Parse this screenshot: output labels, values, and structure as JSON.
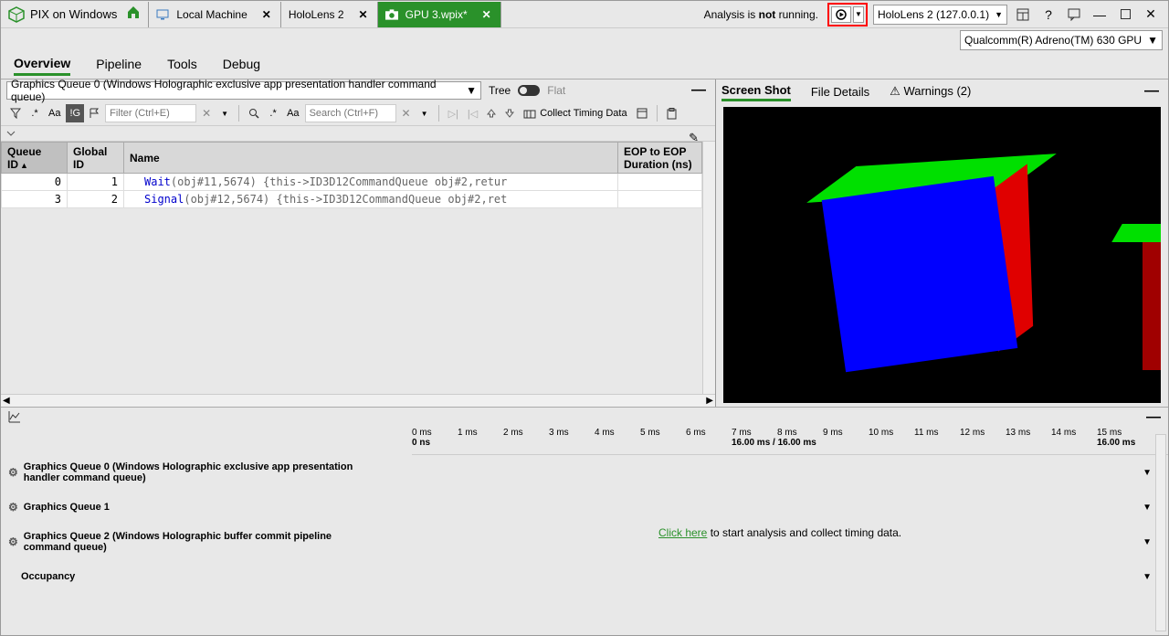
{
  "app": {
    "title": "PIX on Windows"
  },
  "documents": [
    {
      "label": "Local Machine"
    },
    {
      "label": "HoloLens 2"
    },
    {
      "label": "GPU 3.wpix*"
    }
  ],
  "status": {
    "prefix": "Analysis is ",
    "bold": "not",
    "suffix": " running."
  },
  "device": {
    "selected": "HoloLens 2 (127.0.0.1)"
  },
  "gpu": {
    "selected": "Qualcomm(R) Adreno(TM) 630 GPU"
  },
  "menu": {
    "items": [
      "Overview",
      "Pipeline",
      "Tools",
      "Debug"
    ]
  },
  "queue": {
    "selected": "Graphics Queue 0 (Windows Holographic exclusive app presentation handler command queue)",
    "treeLabel": "Tree",
    "flatLabel": "Flat"
  },
  "filter1": {
    "regex": ".*",
    "aa": "Aa",
    "ig": "!G",
    "placeholder": "Filter (Ctrl+E)"
  },
  "filter2": {
    "regex": ".*",
    "aa": "Aa",
    "placeholder": "Search (Ctrl+F)"
  },
  "collectLabel": "Collect Timing Data",
  "table": {
    "cols": {
      "qid": "Queue ID",
      "gid": "Global ID",
      "name": "Name",
      "dur": "EOP to EOP Duration (ns)"
    },
    "rows": [
      {
        "qid": "0",
        "gid": "1",
        "fn": "Wait",
        "args": "(obj#11,5674)  {this->ID3D12CommandQueue obj#2,retur"
      },
      {
        "qid": "3",
        "gid": "2",
        "fn": "Signal",
        "args": "(obj#12,5674)  {this->ID3D12CommandQueue obj#2,ret"
      }
    ]
  },
  "rightTabs": {
    "screen": "Screen Shot",
    "file": "File Details",
    "warn": "Warnings (2)"
  },
  "timeline": {
    "ticks": [
      {
        "label": "0 ms",
        "sub": "0 ns"
      },
      {
        "label": "1 ms"
      },
      {
        "label": "2 ms"
      },
      {
        "label": "3 ms"
      },
      {
        "label": "4 ms"
      },
      {
        "label": "5 ms"
      },
      {
        "label": "6 ms"
      },
      {
        "label": "7 ms",
        "sub": "16.00 ms / 16.00 ms"
      },
      {
        "label": "8 ms"
      },
      {
        "label": "9 ms"
      },
      {
        "label": "10 ms"
      },
      {
        "label": "11 ms"
      },
      {
        "label": "12 ms"
      },
      {
        "label": "13 ms"
      },
      {
        "label": "14 ms"
      },
      {
        "label": "15 ms",
        "sub": "16.00 ms"
      }
    ],
    "rows": [
      {
        "name": "Graphics Queue 0 (Windows Holographic exclusive app presentation handler command queue)"
      },
      {
        "name": "Graphics Queue 1"
      },
      {
        "name": "Graphics Queue 2 (Windows Holographic buffer commit pipeline command queue)"
      },
      {
        "name": "Occupancy"
      }
    ],
    "message": {
      "link": "Click here",
      "rest": " to start analysis and collect timing data."
    }
  }
}
